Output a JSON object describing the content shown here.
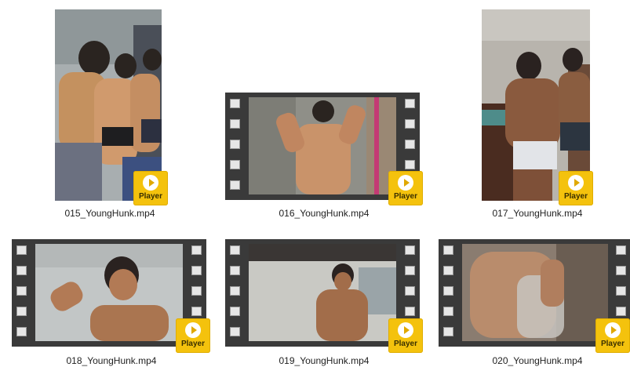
{
  "files": [
    {
      "name": "015_YoungHunk.mp4",
      "badge": "Player",
      "style": "portrait",
      "palette": [
        "#9aa3a6",
        "#c48e62",
        "#5c6070"
      ]
    },
    {
      "name": "016_YoungHunk.mp4",
      "badge": "Player",
      "style": "film",
      "palette": [
        "#8e8e88",
        "#c9936a",
        "#6f6e66"
      ]
    },
    {
      "name": "017_YoungHunk.mp4",
      "badge": "Player",
      "style": "portrait",
      "palette": [
        "#b5b1aa",
        "#8a5a3e",
        "#3e2a22"
      ]
    },
    {
      "name": "018_YoungHunk.mp4",
      "badge": "Player",
      "style": "film",
      "palette": [
        "#c2c6c6",
        "#b27a55",
        "#8e9092"
      ]
    },
    {
      "name": "019_YoungHunk.mp4",
      "badge": "Player",
      "style": "film",
      "palette": [
        "#c9c9c4",
        "#a26d4a",
        "#7a7874"
      ]
    },
    {
      "name": "020_YoungHunk.mp4",
      "badge": "Player",
      "style": "film",
      "palette": [
        "#9a8a7a",
        "#b98c6c",
        "#6a5d52"
      ]
    }
  ],
  "badge_color": "#f4c20d"
}
